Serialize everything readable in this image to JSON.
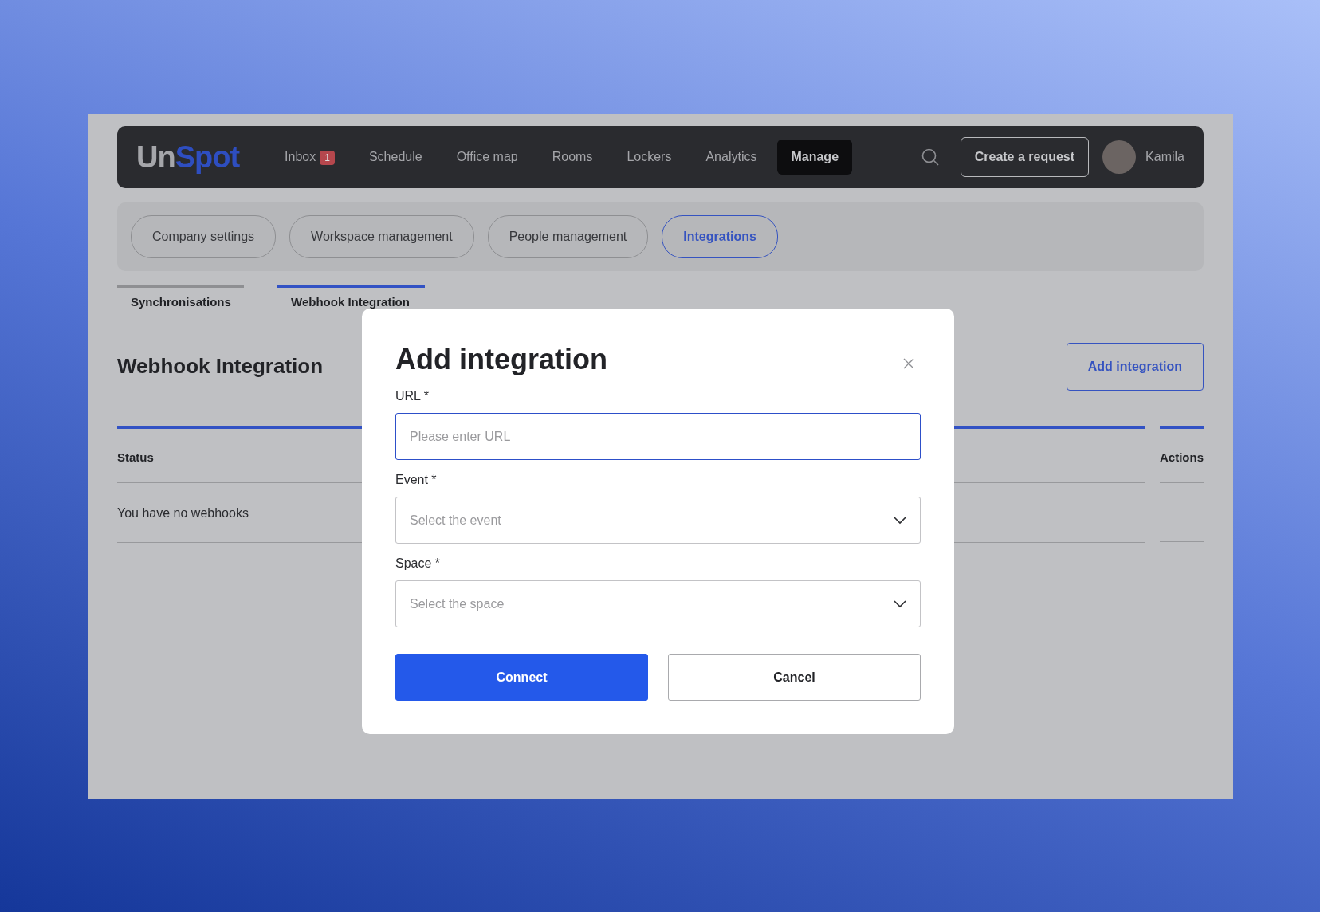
{
  "header": {
    "logo_prefix": "Un",
    "logo_suffix": "Spot",
    "nav": [
      {
        "label": "Inbox",
        "badge": "1",
        "selected": false
      },
      {
        "label": "Schedule",
        "selected": false
      },
      {
        "label": "Office map",
        "selected": false
      },
      {
        "label": "Rooms",
        "selected": false
      },
      {
        "label": "Lockers",
        "selected": false
      },
      {
        "label": "Analytics",
        "selected": false
      },
      {
        "label": "Manage",
        "selected": true
      }
    ],
    "create_button": "Create a request",
    "user_name": "Kamila"
  },
  "settings_tabs": [
    {
      "label": "Company settings",
      "selected": false
    },
    {
      "label": "Workspace management",
      "selected": false
    },
    {
      "label": "People management",
      "selected": false
    },
    {
      "label": "Integrations",
      "selected": true
    }
  ],
  "sub_tabs": [
    {
      "label": "Synchronisations",
      "selected": false
    },
    {
      "label": "Webhook Integration",
      "selected": true
    }
  ],
  "page": {
    "heading": "Webhook Integration",
    "add_button": "Add integration"
  },
  "table": {
    "columns": [
      "Status",
      "Actions"
    ],
    "empty_message": "You have no webhooks"
  },
  "modal": {
    "title": "Add integration",
    "fields": [
      {
        "kind": "text",
        "label": "URL *",
        "placeholder": "Please enter URL",
        "focused": true
      },
      {
        "kind": "select",
        "label": "Event *",
        "placeholder": "Select the event",
        "focused": false
      },
      {
        "kind": "select",
        "label": "Space *",
        "placeholder": "Select the space",
        "focused": false
      }
    ],
    "buttons": [
      {
        "kind": "primary",
        "label": "Connect"
      },
      {
        "kind": "secondary",
        "label": "Cancel"
      }
    ]
  }
}
